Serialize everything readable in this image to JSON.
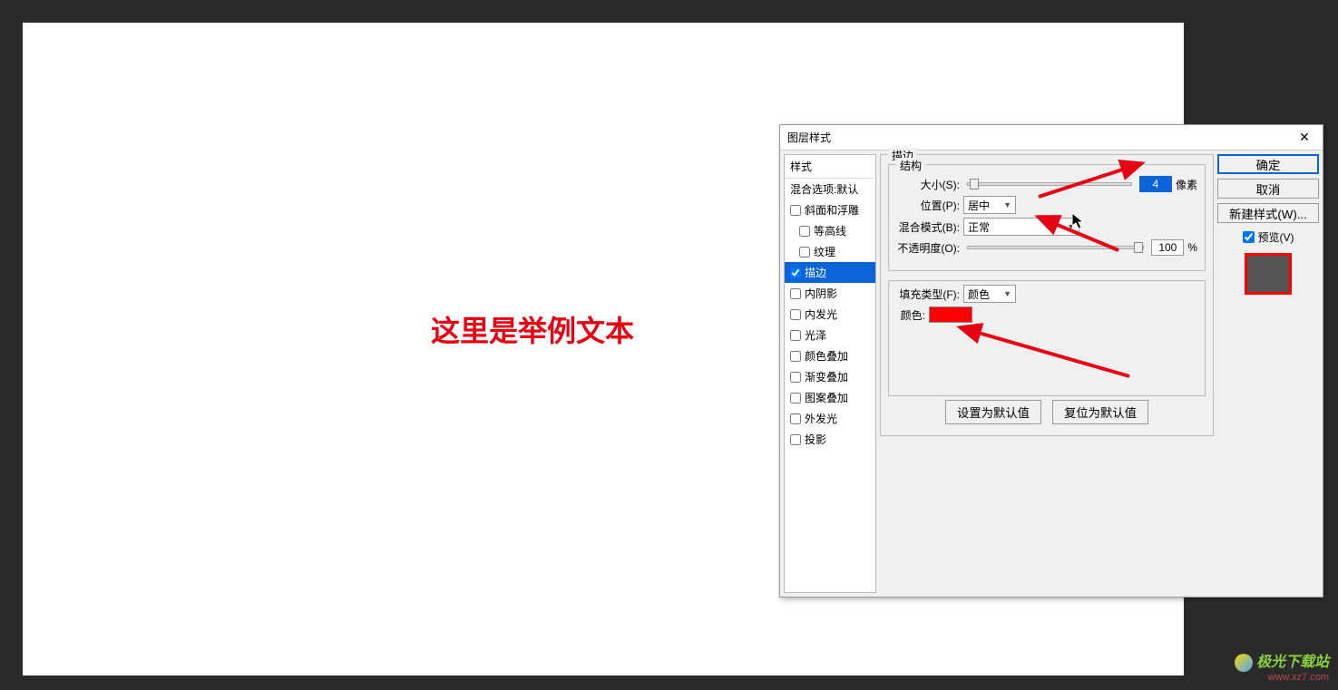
{
  "canvas": {
    "sample_text": "这里是举例文本"
  },
  "dialog": {
    "title": "图层样式",
    "close_glyph": "✕",
    "styles_column": {
      "header": "样式",
      "blend_opts": "混合选项:默认",
      "items": [
        {
          "key": "bevel",
          "label": "斜面和浮雕",
          "checked": false,
          "indent": false
        },
        {
          "key": "contour",
          "label": "等高线",
          "checked": false,
          "indent": true
        },
        {
          "key": "texture",
          "label": "纹理",
          "checked": false,
          "indent": true
        },
        {
          "key": "stroke",
          "label": "描边",
          "checked": true,
          "indent": false,
          "selected": true
        },
        {
          "key": "inner_shadow",
          "label": "内阴影",
          "checked": false,
          "indent": false
        },
        {
          "key": "inner_glow",
          "label": "内发光",
          "checked": false,
          "indent": false
        },
        {
          "key": "satin",
          "label": "光泽",
          "checked": false,
          "indent": false
        },
        {
          "key": "color_overlay",
          "label": "颜色叠加",
          "checked": false,
          "indent": false
        },
        {
          "key": "grad_overlay",
          "label": "渐变叠加",
          "checked": false,
          "indent": false
        },
        {
          "key": "pat_overlay",
          "label": "图案叠加",
          "checked": false,
          "indent": false
        },
        {
          "key": "outer_glow",
          "label": "外发光",
          "checked": false,
          "indent": false
        },
        {
          "key": "drop_shadow",
          "label": "投影",
          "checked": false,
          "indent": false
        }
      ]
    },
    "stroke_panel": {
      "section_label": "描边",
      "structure_label": "结构",
      "size_label": "大小(S):",
      "size_value": "4",
      "size_unit": "像素",
      "position_label": "位置(P):",
      "position_value": "居中",
      "blendmode_label": "混合模式(B):",
      "blendmode_value": "正常",
      "opacity_label": "不透明度(O):",
      "opacity_value": "100",
      "opacity_unit": "%",
      "filltype_label": "填充类型(F):",
      "filltype_value": "颜色",
      "color_label": "颜色:",
      "color_value": "#ff0000",
      "set_default": "设置为默认值",
      "reset_default": "复位为默认值"
    },
    "buttons": {
      "ok": "确定",
      "cancel": "取消",
      "new_style": "新建样式(W)...",
      "preview": "预览(V)"
    }
  },
  "watermark": {
    "line1": "极光下载站",
    "line2": "www.xz7.com"
  }
}
